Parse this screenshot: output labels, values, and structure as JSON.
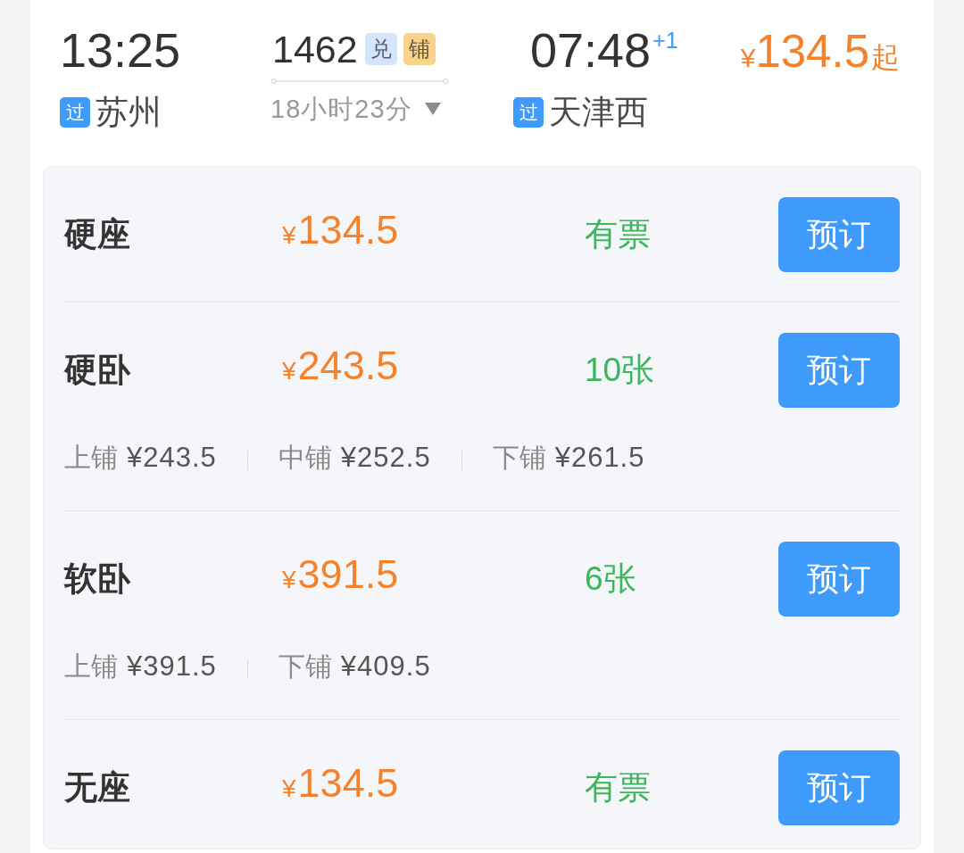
{
  "journey": {
    "departure": {
      "time": "13:25",
      "tag": "过",
      "station": "苏州"
    },
    "train": {
      "number": "1462",
      "tags": [
        {
          "text": "兑",
          "color": "#d3e6fc"
        },
        {
          "text": "铺",
          "color": "#f8d38c"
        }
      ],
      "duration": "18小时23分"
    },
    "arrival": {
      "time": "07:48",
      "day_offset": "+1",
      "tag": "过",
      "station": "天津西"
    },
    "lowest_price": {
      "currency": "¥",
      "amount": "134.5",
      "suffix": "起"
    }
  },
  "seats": [
    {
      "name": "硬座",
      "currency": "¥",
      "price": "134.5",
      "availability": "有票",
      "action": "预订"
    },
    {
      "name": "硬卧",
      "currency": "¥",
      "price": "243.5",
      "availability": "10张",
      "action": "预订",
      "berths": [
        {
          "label": "上铺",
          "price": "¥243.5"
        },
        {
          "label": "中铺",
          "price": "¥252.5"
        },
        {
          "label": "下铺",
          "price": "¥261.5"
        }
      ]
    },
    {
      "name": "软卧",
      "currency": "¥",
      "price": "391.5",
      "availability": "6张",
      "action": "预订",
      "berths": [
        {
          "label": "上铺",
          "price": "¥391.5"
        },
        {
          "label": "下铺",
          "price": "¥409.5"
        }
      ]
    },
    {
      "name": "无座",
      "currency": "¥",
      "price": "134.5",
      "availability": "有票",
      "action": "预订"
    }
  ]
}
